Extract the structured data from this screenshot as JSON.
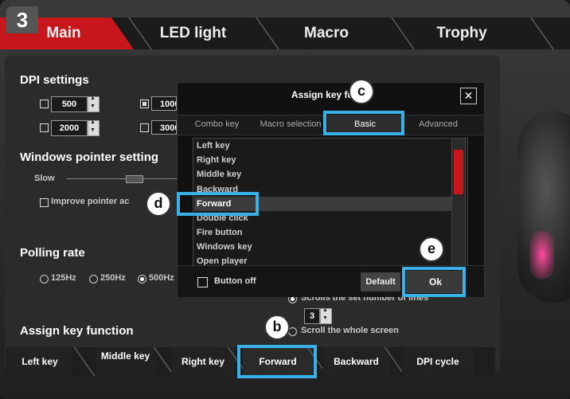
{
  "step_number": "3",
  "tabs": [
    {
      "label": "Main"
    },
    {
      "label": "LED light"
    },
    {
      "label": "Macro"
    },
    {
      "label": "Trophy"
    }
  ],
  "dpi": {
    "heading": "DPI settings",
    "rows": [
      {
        "value": "500",
        "checked": false
      },
      {
        "value": "1000",
        "checked": true
      },
      {
        "value": "2000",
        "checked": false
      },
      {
        "value": "3000",
        "checked": false
      }
    ]
  },
  "pointer": {
    "heading": "Windows pointer setting",
    "slow_label": "Slow",
    "improve_label": "Improve pointer ac"
  },
  "polling": {
    "heading": "Polling rate",
    "options": [
      {
        "label": "125Hz",
        "selected": false
      },
      {
        "label": "250Hz",
        "selected": false
      },
      {
        "label": "500Hz",
        "selected": true
      }
    ]
  },
  "scroll": {
    "option1": "Scrolls the set number of lines",
    "lines_value": "3",
    "option2": "Scroll the whole screen"
  },
  "assign": {
    "heading": "Assign key function",
    "buttons": [
      "Left key",
      "Middle key",
      "Right key",
      "Forward",
      "Backward",
      "DPI cycle"
    ]
  },
  "dialog": {
    "title": "Assign key functi",
    "close_glyph": "✕",
    "tabs": [
      "Combo key",
      "Macro selection",
      "Basic",
      "Advanced"
    ],
    "list_items": [
      "Left key",
      "Right key",
      "Middle key",
      "Backward",
      "Forward",
      "Double click",
      "Fire button",
      "Windows key",
      "Open player"
    ],
    "button_off_label": "Button off",
    "default_label": "Default",
    "ok_label": "Ok"
  },
  "callouts": {
    "b": "b",
    "c": "c",
    "d": "d",
    "e": "e"
  },
  "colors": {
    "accent_red": "#c8161d",
    "highlight_blue": "#3ab0e8"
  }
}
